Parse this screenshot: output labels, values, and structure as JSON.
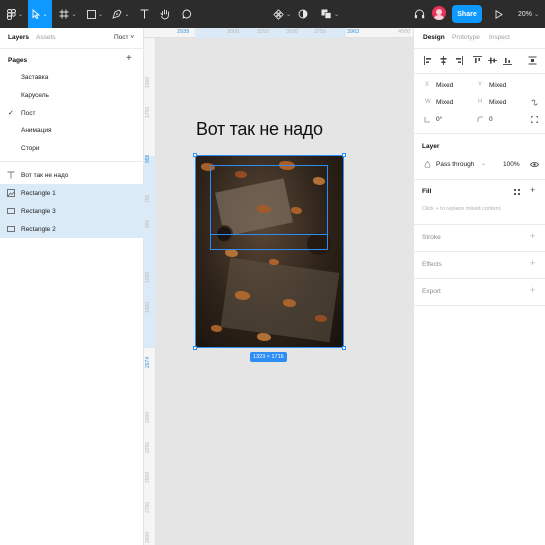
{
  "toolbar": {
    "share_label": "Share",
    "zoom_label": "20%"
  },
  "left_panel": {
    "tabs": [
      "Layers",
      "Assets"
    ],
    "page_dropdown": "Пост ˅",
    "pages_title": "Pages",
    "pages": [
      {
        "label": "Заставка",
        "selected": false
      },
      {
        "label": "Карусель",
        "selected": false
      },
      {
        "label": "Пост",
        "selected": true
      },
      {
        "label": "Анимация",
        "selected": false
      },
      {
        "label": "Стори",
        "selected": false
      }
    ],
    "check_glyph": "✓",
    "layers": [
      {
        "label": "Вот так не надо",
        "icon": "text-icon",
        "selected": false
      },
      {
        "label": "Rectangle 1",
        "icon": "image-icon",
        "selected": true
      },
      {
        "label": "Rectangle 3",
        "icon": "rectangle-icon",
        "selected": true
      },
      {
        "label": "Rectangle 2",
        "icon": "rectangle-icon",
        "selected": true
      }
    ]
  },
  "canvas": {
    "ruler_top": [
      "2939",
      "3000",
      "3250",
      "3500",
      "3750",
      "3963",
      "4500"
    ],
    "ruler_left": [
      "1500",
      "1750",
      "958",
      "750",
      "900",
      "1250",
      "1500",
      "2674",
      "2000",
      "2250",
      "2500",
      "2750",
      "3000"
    ],
    "headline": "Вот так не надо",
    "dimensions": "1323 × 1716"
  },
  "right_panel": {
    "tabs": [
      "Design",
      "Prototype",
      "Inspect"
    ],
    "x_label": "X",
    "x_value": "Mixed",
    "y_label": "Y",
    "y_value": "Mixed",
    "w_label": "W",
    "w_value": "Mixed",
    "h_label": "H",
    "h_value": "Mixed",
    "rotation": "0°",
    "radius": "0",
    "layer_title": "Layer",
    "blend_mode": "Pass through",
    "opacity": "100%",
    "fill_title": "Fill",
    "fill_hint": "Click + to replace mixed content.",
    "stroke_title": "Stroke",
    "effects_title": "Effects",
    "export_title": "Export"
  },
  "colors": {
    "accent": "#0d99ff",
    "toolbar_bg": "#2c2c2c",
    "selection": "#daebf7"
  }
}
